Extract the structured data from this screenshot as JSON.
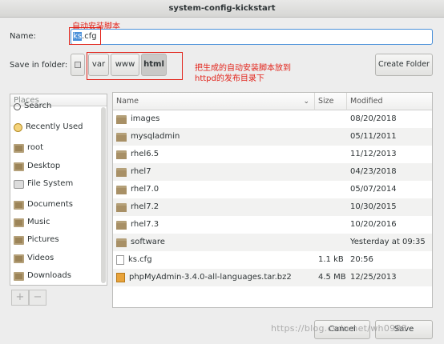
{
  "window": {
    "title": "system-config-kickstart"
  },
  "annotations": {
    "top": "自动安装脚本",
    "middle": "把生成的自动安装脚本放到\nhttpd的发布目录下"
  },
  "name_field": {
    "label": "Name:",
    "selected": "ks",
    "rest": ".cfg"
  },
  "save_in_folder": {
    "label": "Save in folder:",
    "path": [
      "var",
      "www",
      "html"
    ]
  },
  "create_folder_label": "Create Folder",
  "places": {
    "header": "Places",
    "items": [
      {
        "label": "Search",
        "icon": "search-icon"
      },
      {
        "label": "Recently Used",
        "icon": "clock-icon"
      },
      {
        "label": "root",
        "icon": "home-folder-icon"
      },
      {
        "label": "Desktop",
        "icon": "desktop-folder-icon"
      },
      {
        "label": "File System",
        "icon": "drive-icon"
      },
      {
        "label": "Documents",
        "icon": "folder-icon"
      },
      {
        "label": "Music",
        "icon": "folder-icon"
      },
      {
        "label": "Pictures",
        "icon": "folder-icon"
      },
      {
        "label": "Videos",
        "icon": "folder-icon"
      },
      {
        "label": "Downloads",
        "icon": "folder-icon"
      }
    ],
    "add": "+",
    "remove": "−"
  },
  "files": {
    "columns": {
      "name": "Name",
      "size": "Size",
      "modified": "Modified"
    },
    "rows": [
      {
        "name": "images",
        "type": "folder",
        "size": "",
        "modified": "08/20/2018"
      },
      {
        "name": "mysqladmin",
        "type": "folder",
        "size": "",
        "modified": "05/11/2011"
      },
      {
        "name": "rhel6.5",
        "type": "folder",
        "size": "",
        "modified": "11/12/2013"
      },
      {
        "name": "rhel7",
        "type": "folder",
        "size": "",
        "modified": "04/23/2018"
      },
      {
        "name": "rhel7.0",
        "type": "folder",
        "size": "",
        "modified": "05/07/2014"
      },
      {
        "name": "rhel7.2",
        "type": "folder",
        "size": "",
        "modified": "10/30/2015"
      },
      {
        "name": "rhel7.3",
        "type": "folder",
        "size": "",
        "modified": "10/20/2016"
      },
      {
        "name": "software",
        "type": "folder",
        "size": "",
        "modified": "Yesterday at 09:35"
      },
      {
        "name": "ks.cfg",
        "type": "file",
        "size": "1.1 kB",
        "modified": "20:56"
      },
      {
        "name": "phpMyAdmin-3.4.0-all-languages.tar.bz2",
        "type": "archive",
        "size": "4.5 MB",
        "modified": "12/25/2013"
      }
    ]
  },
  "buttons": {
    "cancel": "Cancel",
    "save": "Save"
  },
  "watermark": "https://blog.csdn.net/wh0988"
}
